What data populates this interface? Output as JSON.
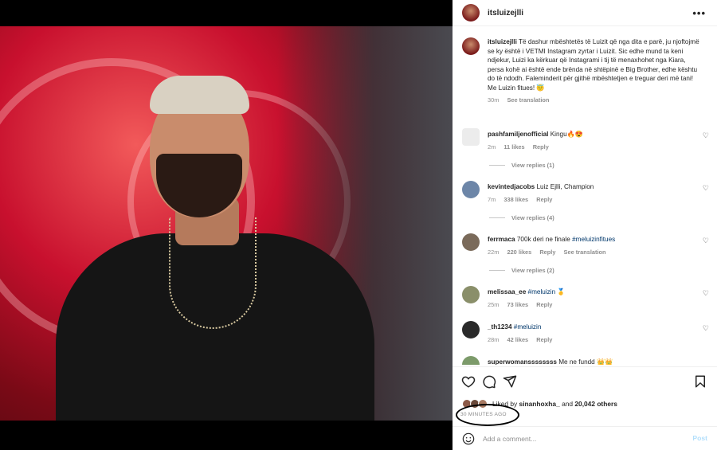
{
  "post": {
    "username": "itsluizejlli",
    "caption_user": "itsluizejlli",
    "caption_text": "Të dashur mbështetës të Luizit që nga dita e parë, ju njoftojmë se ky është i VETMI Instagram zyrtar i Luizit. Sic edhe mund ta keni ndjekur, Luizi ka kërkuar që Instagrami i tij të menaxhohet nga Kiara, persa kohë ai është ende brënda në shtëpinë e Big Brother, edhe kështu do të ndodh. Faleminderit për gjithë mbështetjen e treguar deri më tani!",
    "caption_line2": "Me Luizin fitues! 😇",
    "caption_time": "30m",
    "caption_translation": "See translation"
  },
  "comments": [
    {
      "user": "pashfamiljenofficial",
      "text": "Kingu🔥😍",
      "time": "2m",
      "likes": "11 likes",
      "reply": "Reply",
      "replies": "View replies (1)"
    },
    {
      "user": "kevintedjacobs",
      "text": "Luiz Ejlli, Champion",
      "time": "7m",
      "likes": "338 likes",
      "reply": "Reply",
      "replies": "View replies (4)"
    },
    {
      "user": "ferrmaca",
      "text": "700k deri ne finale",
      "hashtag": "#meluizinfitues",
      "time": "22m",
      "likes": "220 likes",
      "reply": "Reply",
      "translation": "See translation",
      "replies": "View replies (2)"
    },
    {
      "user": "melissaa_ee",
      "hashtag": "#meluizin",
      "text": "🥇",
      "time": "25m",
      "likes": "73 likes",
      "reply": "Reply"
    },
    {
      "user": "_th1234",
      "hashtag": "#meluizin",
      "time": "28m",
      "likes": "42 likes",
      "reply": "Reply"
    },
    {
      "user": "superwomanssssssss",
      "text": "Me ne fundd 👑👑"
    }
  ],
  "likes": {
    "prefix": "Liked by",
    "user": "sinanhoxha_",
    "and": "and",
    "others": "20,042 others"
  },
  "timestamp": "30 MINUTES AGO",
  "add_comment": {
    "placeholder": "Add a comment...",
    "post_label": "Post"
  },
  "icons": {
    "more": "more-options-icon",
    "heart": "heart-icon",
    "comment": "comment-icon",
    "share": "share-icon",
    "save": "bookmark-icon",
    "emoji": "emoji-icon"
  }
}
